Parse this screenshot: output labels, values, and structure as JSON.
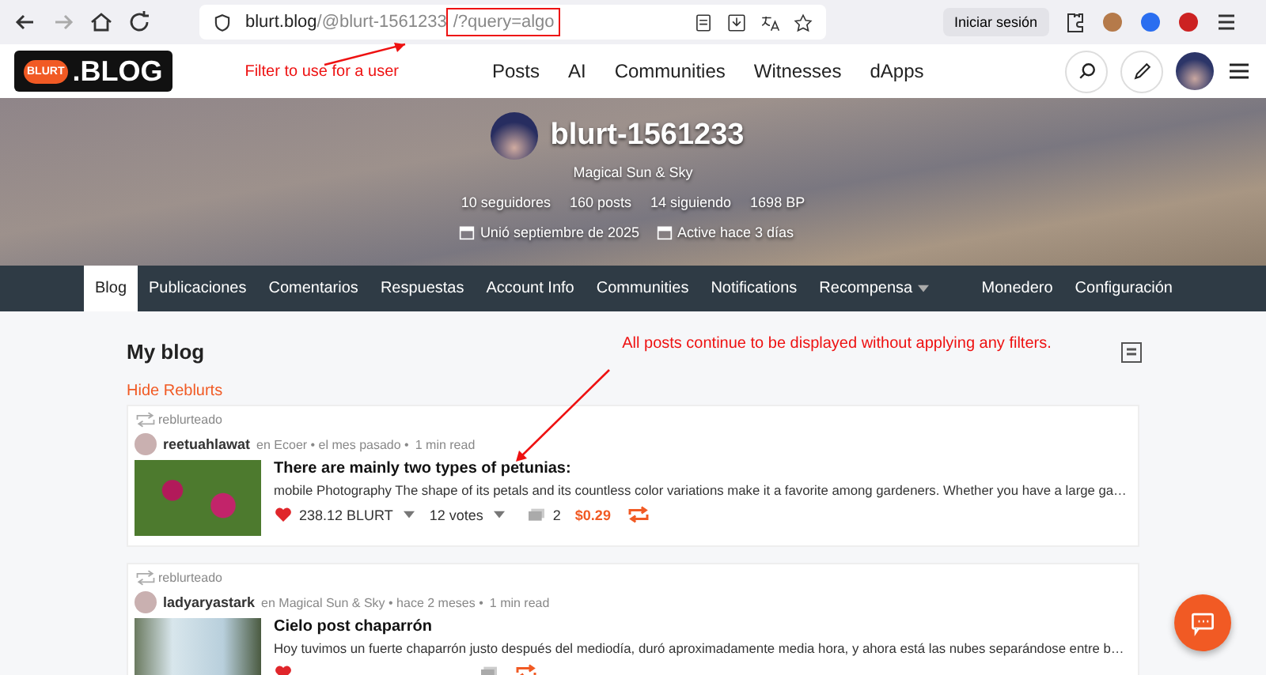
{
  "browser": {
    "url_domain": "blurt.blog",
    "url_path": "/@blurt-1561233",
    "url_query": "/?query=algo",
    "sign_in": "Iniciar sesión"
  },
  "annotations": [
    {
      "kind": "url",
      "text": "Filter to use for a user"
    },
    {
      "kind": "posts",
      "text": "All posts continue to be displayed without applying any filters."
    }
  ],
  "header": {
    "logo_badge": "BLURT",
    "logo_text": ".BLOG",
    "nav": [
      "Posts",
      "AI",
      "Communities",
      "Witnesses",
      "dApps"
    ]
  },
  "profile": {
    "name": "blurt-1561233",
    "tagline": "Magical Sun & Sky",
    "stats": [
      "10 seguidores",
      "160 posts",
      "14 siguiendo",
      "1698 BP"
    ],
    "joined": "Unió septiembre de 2025",
    "active": "Active hace 3 días"
  },
  "tabs": [
    {
      "label": "Blog",
      "selected": true,
      "dropdown": false
    },
    {
      "label": "Publicaciones",
      "selected": false,
      "dropdown": false
    },
    {
      "label": "Comentarios",
      "selected": false,
      "dropdown": false
    },
    {
      "label": "Respuestas",
      "selected": false,
      "dropdown": false
    },
    {
      "label": "Account Info",
      "selected": false,
      "dropdown": false
    },
    {
      "label": "Communities",
      "selected": false,
      "dropdown": false
    },
    {
      "label": "Notifications",
      "selected": false,
      "dropdown": false
    },
    {
      "label": "Recompensa",
      "selected": false,
      "dropdown": true
    }
  ],
  "tabs_right": [
    "Monedero",
    "Configuración"
  ],
  "blog": {
    "title": "My blog",
    "hide_reblurts": "Hide Reblurts"
  },
  "posts": [
    {
      "reblog_label": "reblurteado",
      "author": "reetuahlawat",
      "meta": "en Ecoer • el mes pasado •",
      "read": "1 min read",
      "title": "There are mainly two types of petunias:",
      "excerpt": "mobile Photography The shape of its petals and its countless color variations make it a favorite among gardeners. Whether you have a large ga…",
      "amount": "238.12 BLURT",
      "votes": "12 votes",
      "comments": "2",
      "payout": "$0.29"
    },
    {
      "reblog_label": "reblurteado",
      "author": "ladyaryastark",
      "meta": "en Magical Sun & Sky • hace 2 meses •",
      "read": "1 min read",
      "title": "Cielo post chaparrón",
      "excerpt": "Hoy tuvimos un fuerte chaparrón justo después del mediodía, duró aproximadamente media hora, y ahora está las nubes separándose entre b…"
    }
  ]
}
